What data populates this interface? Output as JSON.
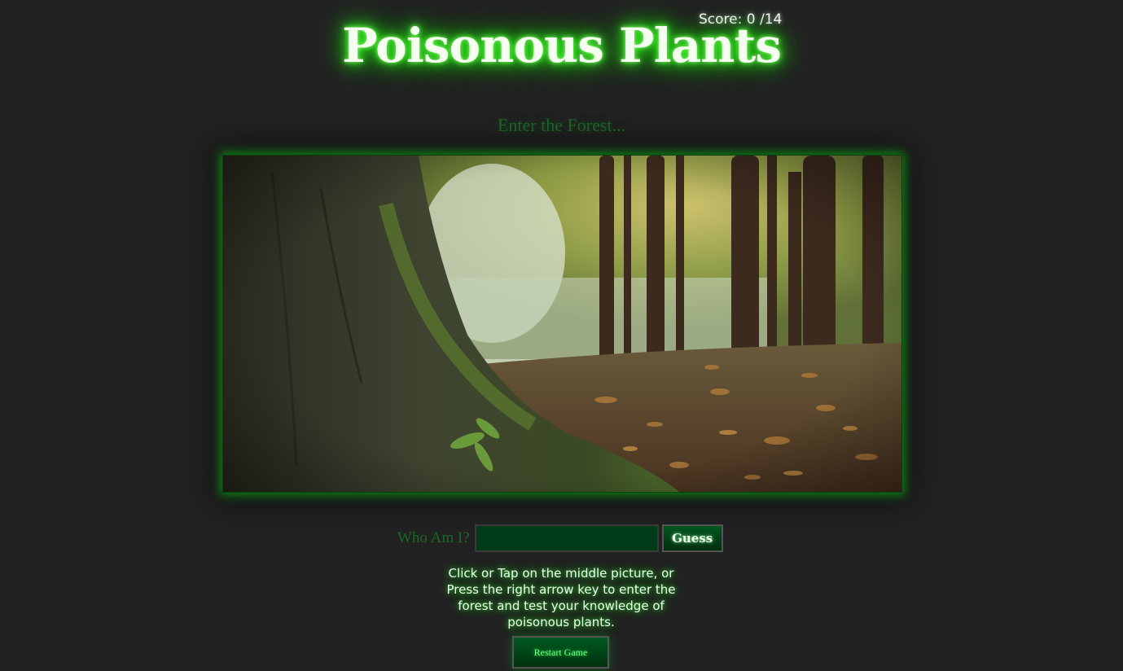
{
  "header": {
    "score_text": "Score: 0 /14",
    "title": "Poisonous Plants"
  },
  "scene": {
    "subtitle": "Enter the Forest..."
  },
  "guess": {
    "label": "Who Am I?",
    "input_value": "",
    "button_label": "Guess"
  },
  "instructions": {
    "text": "Click or Tap on the middle picture, or Press the right arrow key to enter the forest and test your knowledge of poisonous plants."
  },
  "controls": {
    "restart_label": "Restart Game"
  },
  "colors": {
    "background": "#222222",
    "glow_green": "#22dd11",
    "input_bg": "#003b17"
  }
}
